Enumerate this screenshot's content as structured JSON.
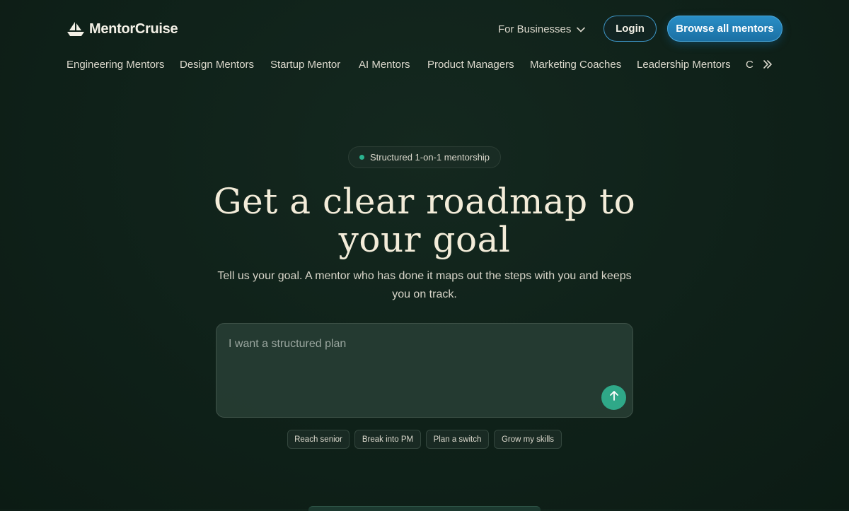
{
  "brand": {
    "name": "MentorCruise",
    "icon": "sailboat-icon"
  },
  "header": {
    "for_businesses": "For Businesses",
    "login": "Login",
    "browse": "Browse all mentors"
  },
  "categories": [
    "Engineering Mentors",
    "Design Mentors",
    "Startup Mentor",
    "AI Mentors",
    "Product Managers",
    "Marketing Coaches",
    "Leadership Mentors",
    "C"
  ],
  "hero": {
    "badge": "Structured 1-on-1 mentorship",
    "title_line1": "Get a clear roadmap to",
    "title_line2": "your goal",
    "subtitle_line1": "Tell us your goal. A mentor who has done it maps out the steps with you and keeps",
    "subtitle_line2": "you on track."
  },
  "goal_input": {
    "placeholder": "I want a structured plan",
    "value": ""
  },
  "suggestions": [
    "Reach senior",
    "Break into PM",
    "Plan a switch",
    "Grow my skills"
  ],
  "colors": {
    "background": "#0f2119",
    "accent_blue": "#1f7fb6",
    "accent_green": "#2fa888",
    "text_cream": "#f3ecd9"
  }
}
